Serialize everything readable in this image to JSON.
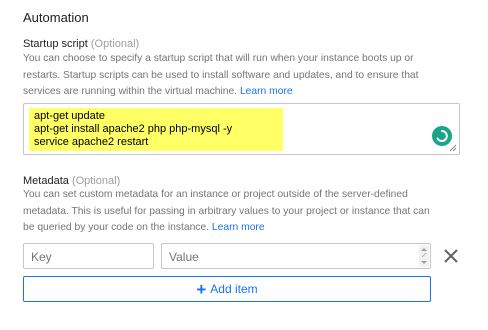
{
  "section": {
    "title": "Automation"
  },
  "startup_script": {
    "label": "Startup script",
    "optional": "(Optional)",
    "help_lines": [
      "You can choose to specify a startup script that will run when your instance boots up or",
      "restarts. Startup scripts can be used to install software and updates, and to ensure that",
      "services are running within the virtual machine."
    ],
    "learn_more": "Learn more",
    "lines": [
      "apt-get update",
      "apt-get install apache2 php php-mysql -y",
      "service apache2 restart"
    ],
    "highlight_color": "#ffff66",
    "spinner_color": "#1aa58a"
  },
  "metadata": {
    "label": "Metadata",
    "optional": "(Optional)",
    "help_lines": [
      "You can set custom metadata for an instance or project outside of the server-defined",
      "metadata. This is useful for passing in arbitrary values to your project or instance that can",
      "be queried by your code on the instance."
    ],
    "learn_more": "Learn more",
    "key_placeholder": "Key",
    "value_placeholder": "Value",
    "add_item_label": "Add item",
    "accent_color": "#1a73e8"
  }
}
